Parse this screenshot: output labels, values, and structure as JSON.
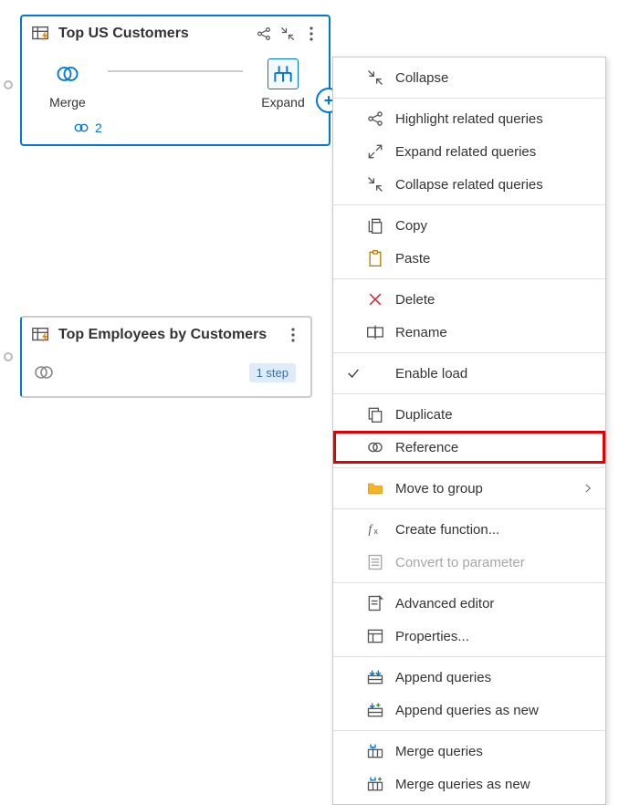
{
  "card1": {
    "title": "Top US Customers",
    "steps": [
      {
        "label": "Merge"
      },
      {
        "label": "Expand"
      }
    ],
    "ref_count": "2"
  },
  "card2": {
    "title": "Top Employees by Customers",
    "step_badge": "1 step"
  },
  "menu": {
    "items": [
      {
        "icon": "collapse",
        "label": "Collapse"
      },
      {
        "icon": "highlight-related",
        "label": "Highlight related queries",
        "sep_before": true
      },
      {
        "icon": "expand-related",
        "label": "Expand related queries"
      },
      {
        "icon": "collapse-related",
        "label": "Collapse related queries"
      },
      {
        "icon": "copy",
        "label": "Copy",
        "sep_before": true
      },
      {
        "icon": "paste",
        "label": "Paste"
      },
      {
        "icon": "delete",
        "label": "Delete",
        "sep_before": true
      },
      {
        "icon": "rename",
        "label": "Rename"
      },
      {
        "icon": "",
        "label": "Enable load",
        "sep_before": true,
        "checked": true
      },
      {
        "icon": "duplicate",
        "label": "Duplicate",
        "sep_before": true
      },
      {
        "icon": "reference",
        "label": "Reference",
        "highlight": true
      },
      {
        "icon": "folder",
        "label": "Move to group",
        "sep_before": true,
        "submenu": true
      },
      {
        "icon": "fx",
        "label": "Create function...",
        "sep_before": true
      },
      {
        "icon": "param",
        "label": "Convert to parameter",
        "disabled": true
      },
      {
        "icon": "advanced",
        "label": "Advanced editor",
        "sep_before": true
      },
      {
        "icon": "props",
        "label": "Properties..."
      },
      {
        "icon": "append",
        "label": "Append queries",
        "sep_before": true
      },
      {
        "icon": "append-new",
        "label": "Append queries as new"
      },
      {
        "icon": "merge-q",
        "label": "Merge queries",
        "sep_before": true
      },
      {
        "icon": "merge-q-new",
        "label": "Merge queries as new"
      }
    ]
  }
}
